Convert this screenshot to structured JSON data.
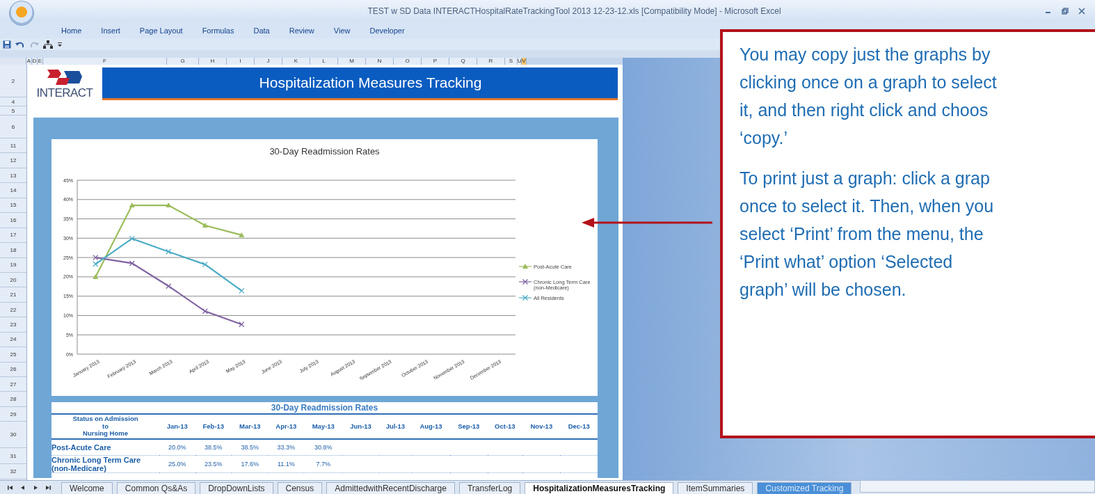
{
  "window": {
    "title": "TEST w SD Data INTERACTHospitalRateTrackingTool 2013 12-23-12.xls  [Compatibility Mode] - Microsoft Excel"
  },
  "ribbon_tabs": [
    "Home",
    "Insert",
    "Page Layout",
    "Formulas",
    "Data",
    "Review",
    "View",
    "Developer"
  ],
  "column_headers": [
    {
      "label": "A",
      "selected": false
    },
    {
      "label": "D",
      "selected": false
    },
    {
      "label": "E",
      "selected": false
    },
    {
      "label": "F",
      "selected": false
    },
    {
      "label": "G",
      "selected": false
    },
    {
      "label": "H",
      "selected": false
    },
    {
      "label": "I",
      "selected": false
    },
    {
      "label": "J",
      "selected": false
    },
    {
      "label": "K",
      "selected": false
    },
    {
      "label": "L",
      "selected": false
    },
    {
      "label": "M",
      "selected": false
    },
    {
      "label": "N",
      "selected": false
    },
    {
      "label": "O",
      "selected": false
    },
    {
      "label": "P",
      "selected": false
    },
    {
      "label": "Q",
      "selected": false
    },
    {
      "label": "R",
      "selected": false
    },
    {
      "label": "S",
      "selected": false
    },
    {
      "label": "U",
      "selected": false
    },
    {
      "label": "V",
      "selected": true
    }
  ],
  "row_headers": [
    "2",
    "4",
    "5",
    "6",
    "11",
    "12",
    "13",
    "14",
    "15",
    "16",
    "17",
    "18",
    "19",
    "20",
    "21",
    "22",
    "23",
    "24",
    "25",
    "26",
    "27",
    "28",
    "29",
    "30",
    "31",
    "32"
  ],
  "sheet": {
    "logo_text": "INTERACT",
    "title": "Hospitalization Measures Tracking",
    "chart": {
      "chart_data": {
        "type": "line",
        "title": "30-Day Readmission Rates",
        "categories": [
          "January 2013",
          "February 2013",
          "March 2013",
          "April 2013",
          "May 2013",
          "June 2013",
          "July 2013",
          "August 2013",
          "September 2013",
          "October 2013",
          "November 2013",
          "December 2013"
        ],
        "series": [
          {
            "name": "Post-Acute Care",
            "color": "#9bbb59",
            "marker": "triangle",
            "values": [
              20.0,
              38.5,
              38.5,
              33.3,
              30.8,
              null,
              null,
              null,
              null,
              null,
              null,
              null
            ]
          },
          {
            "name": "Chronic Long Term Care (non-Medicare)",
            "color": "#8064a2",
            "marker": "cross",
            "values": [
              25.0,
              23.5,
              17.6,
              11.1,
              7.7,
              null,
              null,
              null,
              null,
              null,
              null,
              null
            ]
          },
          {
            "name": "All Residents",
            "color": "#4bacc6",
            "marker": "cross",
            "values": [
              23.3,
              29.9,
              26.5,
              23.2,
              16.4,
              null,
              null,
              null,
              null,
              null,
              null,
              null
            ]
          }
        ],
        "grid": {
          "y": true
        },
        "legend": true,
        "ylim": [
          0,
          45
        ],
        "yticks": [
          {
            "value": 0,
            "label": "0%"
          },
          {
            "value": 5,
            "label": "5%"
          },
          {
            "value": 10,
            "label": "10%"
          },
          {
            "value": 15,
            "label": "15%"
          },
          {
            "value": 20,
            "label": "20%"
          },
          {
            "value": 25,
            "label": "25%"
          },
          {
            "value": 30,
            "label": "30%"
          },
          {
            "value": 35,
            "label": "35%"
          },
          {
            "value": 40,
            "label": "40%"
          },
          {
            "value": 45,
            "label": "45%"
          }
        ]
      }
    },
    "table": {
      "title": "30-Day Readmission Rates",
      "header_lines": [
        "Status on Admission",
        "to",
        "Nursing Home"
      ],
      "months": [
        "Jan-13",
        "Feb-13",
        "Mar-13",
        "Apr-13",
        "May-13",
        "Jun-13",
        "Jul-13",
        "Aug-13",
        "Sep-13",
        "Oct-13",
        "Nov-13",
        "Dec-13"
      ],
      "rows": [
        {
          "label_lines": [
            "Post-Acute Care"
          ],
          "values": [
            "20.0%",
            "38.5%",
            "38.5%",
            "33.3%",
            "30.8%"
          ]
        },
        {
          "label_lines": [
            "Chronic Long Term Care",
            "(non-Medicare)"
          ],
          "values": [
            "25.0%",
            "23.5%",
            "17.6%",
            "11.1%",
            "7.7%"
          ]
        }
      ]
    }
  },
  "callout": {
    "paragraphs": [
      [
        "You may copy just the graphs by",
        "clicking once on a graph to select",
        "it, and then right click and choos",
        "‘copy.’"
      ],
      [
        "To print just a graph: click a grap",
        "once to select it. Then, when you",
        "select ‘Print’ from the menu, the",
        "‘Print what’ option ‘Selected",
        "graph’ will be chosen."
      ]
    ]
  },
  "sheet_tabs": [
    {
      "label": "Welcome",
      "selected": false,
      "kind": "plain"
    },
    {
      "label": "Common Qs&As",
      "selected": false,
      "kind": "plain"
    },
    {
      "label": "DropDownLists",
      "selected": false,
      "kind": "plain"
    },
    {
      "label": "Census",
      "selected": false,
      "kind": "plain"
    },
    {
      "label": "AdmittedwithRecentDischarge",
      "selected": false,
      "kind": "plain"
    },
    {
      "label": "TransferLog",
      "selected": false,
      "kind": "plain"
    },
    {
      "label": "HospitalizationMeasuresTracking",
      "selected": true,
      "kind": "plain"
    },
    {
      "label": "ItemSummaries",
      "selected": false,
      "kind": "plain"
    },
    {
      "label": "Customized Tracking",
      "selected": false,
      "kind": "colored"
    }
  ]
}
